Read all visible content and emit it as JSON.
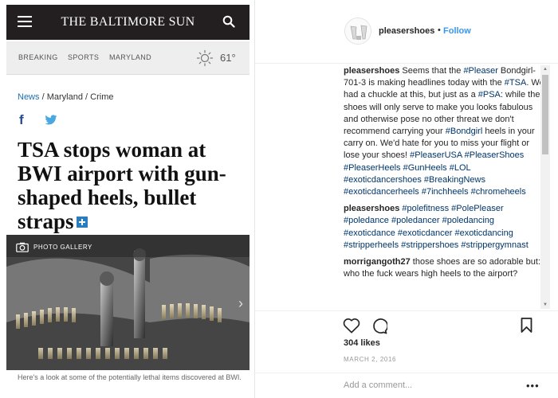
{
  "article": {
    "masthead_title": "THE BALTIMORE SUN",
    "nav": [
      "BREAKING",
      "SPORTS",
      "MARYLAND"
    ],
    "temperature": "61°",
    "breadcrumb": {
      "section": "News",
      "sub1": "Maryland",
      "sub2": "Crime"
    },
    "headline": "TSA stops woman at BWI airport with gun-shaped heels, bullet straps",
    "gallery_label": "PHOTO GALLERY",
    "caption": "Here's a look at some of the potentially lethal items discovered at BWI."
  },
  "post": {
    "username": "pleasershoes",
    "follow_label": "Follow",
    "comments": [
      {
        "user": "pleasershoes",
        "parts": [
          {
            "t": " Seems that the "
          },
          {
            "tag": "#Pleaser"
          },
          {
            "t": " Bondgirl-701-3 is making headlines today with the "
          },
          {
            "tag": "#TSA"
          },
          {
            "t": ". We had a chuckle at this, but just as a "
          },
          {
            "tag": "#PSA"
          },
          {
            "t": ": while the shoes will only serve to make you looks fabulous and otherwise pose no other threat we don't recommend carrying your "
          },
          {
            "tag": "#Bondgirl"
          },
          {
            "t": " heels in your carry on. We'd hate for you to miss your flight or lose your shoes! "
          },
          {
            "tag": "#PleaserUSA"
          },
          {
            "t": " "
          },
          {
            "tag": "#PleaserShoes"
          },
          {
            "t": " "
          },
          {
            "tag": "#PleaserHeels"
          },
          {
            "t": " "
          },
          {
            "tag": "#GunHeels"
          },
          {
            "t": " "
          },
          {
            "tag": "#LOL"
          },
          {
            "t": " "
          },
          {
            "tag": "#exoticdancershoes"
          },
          {
            "t": " "
          },
          {
            "tag": "#BreakingNews"
          },
          {
            "t": " "
          },
          {
            "tag": "#exoticdancerheels"
          },
          {
            "t": " "
          },
          {
            "tag": "#7inchheels"
          },
          {
            "t": " "
          },
          {
            "tag": "#chromeheels"
          }
        ]
      },
      {
        "user": "pleasershoes",
        "parts": [
          {
            "t": " "
          },
          {
            "tag": "#polefitness"
          },
          {
            "t": " "
          },
          {
            "tag": "#PolePleaser"
          },
          {
            "t": " "
          },
          {
            "tag": "#poledance"
          },
          {
            "t": " "
          },
          {
            "tag": "#poledancer"
          },
          {
            "t": " "
          },
          {
            "tag": "#poledancing"
          },
          {
            "t": " "
          },
          {
            "tag": "#exoticdance"
          },
          {
            "t": " "
          },
          {
            "tag": "#exoticdancer"
          },
          {
            "t": " "
          },
          {
            "tag": "#exoticdancing"
          },
          {
            "t": " "
          },
          {
            "tag": "#stripperheels"
          },
          {
            "t": " "
          },
          {
            "tag": "#strippershoes"
          },
          {
            "t": " "
          },
          {
            "tag": "#strippergymnast"
          }
        ]
      },
      {
        "user": "morrigangoth27",
        "parts": [
          {
            "t": " those shoes are so adorable but: who the fuck wears high heels to the airport?"
          }
        ]
      }
    ],
    "likes": "304 likes",
    "date": "MARCH 2, 2016",
    "comment_placeholder": "Add a comment...",
    "more_label": "•••"
  },
  "colors": {
    "masthead_bg": "#231f20",
    "link_blue": "#3897f0",
    "hashtag": "#003569",
    "breadcrumb_blue": "#1a6fb5"
  },
  "icons": [
    "menu-icon",
    "search-icon",
    "sun-icon",
    "facebook-icon",
    "twitter-icon",
    "plus-icon",
    "camera-icon",
    "chevron-right-icon",
    "heart-icon",
    "comment-icon",
    "bookmark-icon",
    "more-icon"
  ]
}
